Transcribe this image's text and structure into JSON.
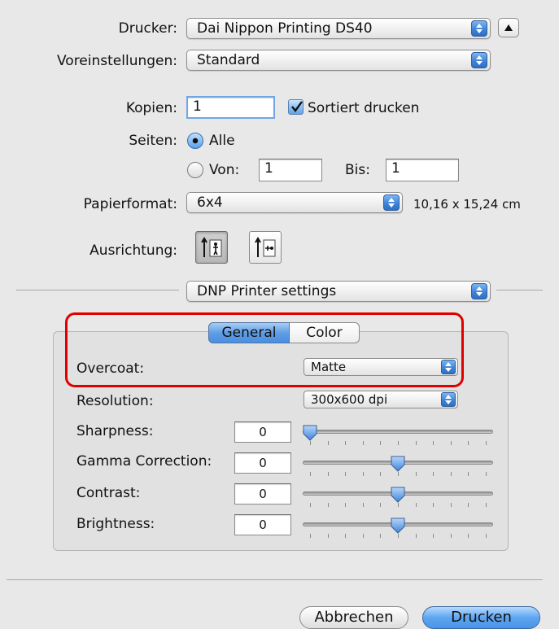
{
  "printer": {
    "label": "Drucker:",
    "value": "Dai Nippon Printing DS40"
  },
  "presets": {
    "label": "Voreinstellungen:",
    "value": "Standard"
  },
  "copies": {
    "label": "Kopien:",
    "value": "1",
    "collate_label": "Sortiert drucken",
    "collate_checked": true
  },
  "pages": {
    "label": "Seiten:",
    "all_label": "Alle",
    "from_label": "Von:",
    "from_value": "1",
    "to_label": "Bis:",
    "to_value": "1",
    "selected": "all"
  },
  "paper": {
    "label": "Papierformat:",
    "value": "6x4",
    "size_text": "10,16 x 15,24 cm"
  },
  "orientation": {
    "label": "Ausrichtung:",
    "selected": "portrait"
  },
  "section_popup": {
    "value": "DNP Printer settings"
  },
  "tabs": [
    {
      "label": "General",
      "selected": true
    },
    {
      "label": "Color",
      "selected": false
    }
  ],
  "settings": {
    "overcoat": {
      "label": "Overcoat:",
      "value": "Matte"
    },
    "resolution": {
      "label": "Resolution:",
      "value": "300x600 dpi"
    },
    "sharpness": {
      "label": "Sharpness:",
      "value": "0",
      "slider_level": 0.0
    },
    "gamma": {
      "label": "Gamma Correction:",
      "value": "0",
      "slider_level": 0.5
    },
    "contrast": {
      "label": "Contrast:",
      "value": "0",
      "slider_level": 0.5
    },
    "brightness": {
      "label": "Brightness:",
      "value": "0",
      "slider_level": 0.5
    }
  },
  "buttons": {
    "cancel": "Abbrechen",
    "print": "Drucken"
  },
  "colors": {
    "accent": "#4a94e6",
    "highlight": "#e00000"
  }
}
